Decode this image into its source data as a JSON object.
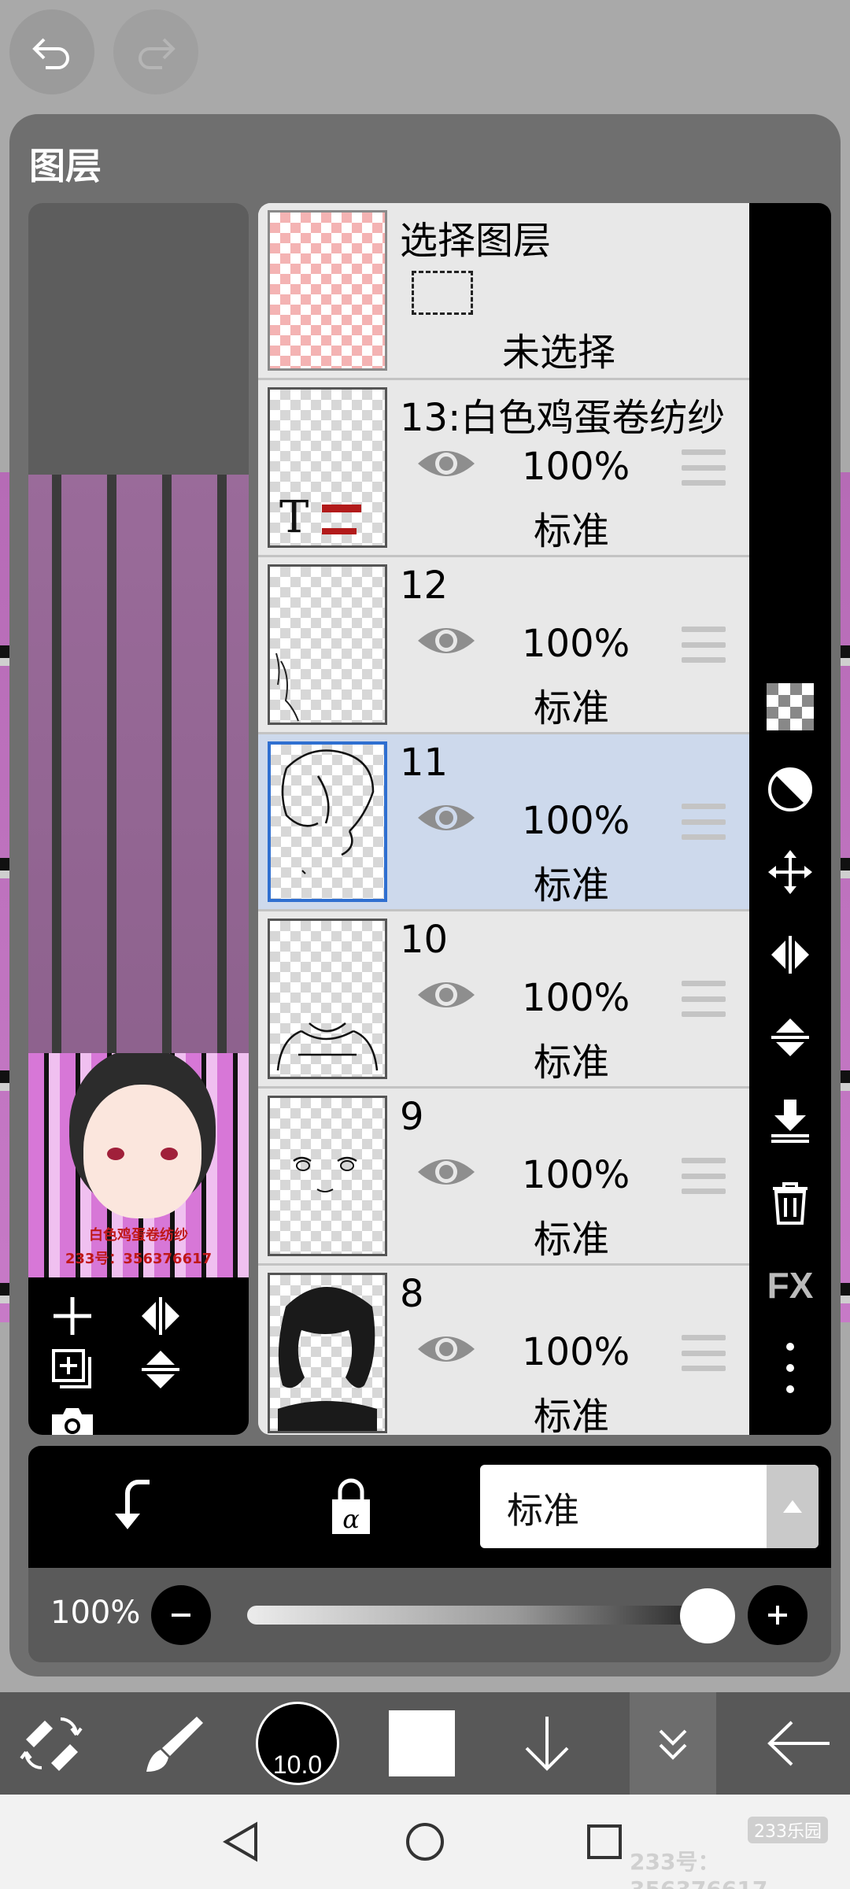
{
  "panel": {
    "title": "图层"
  },
  "preview": {
    "caption_line1": "白色鸡蛋卷纺纱",
    "caption_line2": "233号：356376617"
  },
  "selection_row": {
    "title": "选择图层",
    "status": "未选择"
  },
  "layers": [
    {
      "name": "13:白色鸡蛋卷纺纱",
      "opacity": "100%",
      "blend": "标准",
      "visible": true,
      "thumb_text": "T",
      "selected": false
    },
    {
      "name": "12",
      "opacity": "100%",
      "blend": "标准",
      "visible": true,
      "selected": false
    },
    {
      "name": "11",
      "opacity": "100%",
      "blend": "标准",
      "visible": true,
      "selected": true
    },
    {
      "name": "10",
      "opacity": "100%",
      "blend": "标准",
      "visible": true,
      "selected": false
    },
    {
      "name": "9",
      "opacity": "100%",
      "blend": "标准",
      "visible": true,
      "selected": false
    },
    {
      "name": "8",
      "opacity": "100%",
      "blend": "标准",
      "visible": true,
      "selected": false
    }
  ],
  "right_toolbar": {
    "fx_label": "FX"
  },
  "blend_mode": {
    "value": "标准"
  },
  "layer_opacity": {
    "label": "100%",
    "value_fraction": 1.0
  },
  "bottom_toolbar": {
    "brush_size": "10.0",
    "color": "#ffffff"
  },
  "watermark": {
    "badge": "233乐园",
    "id": "233号：356376617"
  },
  "colors": {
    "selected_row": "#cdd9ec",
    "panel": "#6f6f6f",
    "accent": "#2f6fd0"
  }
}
